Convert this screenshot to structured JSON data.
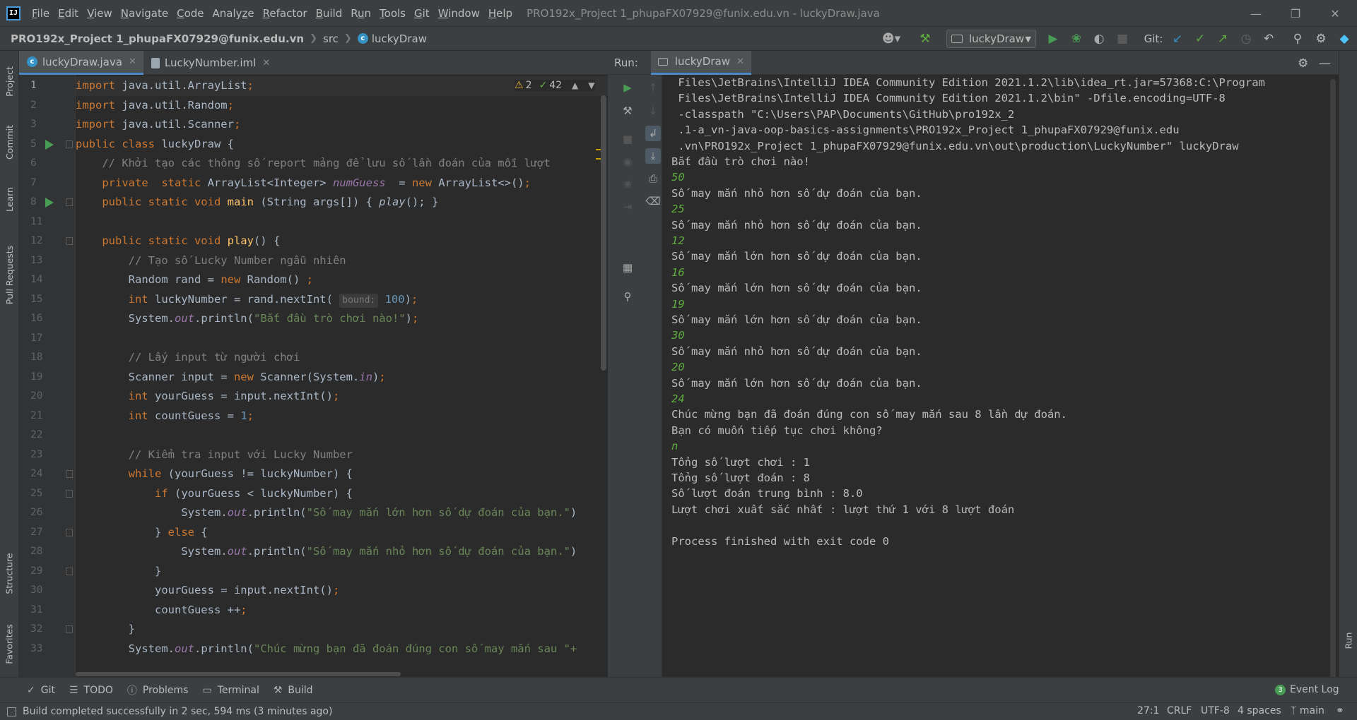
{
  "menubar": {
    "items": [
      "File",
      "Edit",
      "View",
      "Navigate",
      "Code",
      "Analyze",
      "Refactor",
      "Build",
      "Run",
      "Tools",
      "Git",
      "Window",
      "Help"
    ],
    "mnemonics": [
      "F",
      "E",
      "V",
      "N",
      "C",
      "z",
      "R",
      "B",
      "u",
      "T",
      "G",
      "W",
      "H"
    ],
    "window_title": "PRO192x_Project 1_phupaFX07929@funix.edu.vn - luckyDraw.java"
  },
  "navbar": {
    "project": "PRO192x_Project 1_phupaFX07929@funix.edu.vn",
    "folder": "src",
    "file": "luckyDraw",
    "run_config": "luckyDraw",
    "git_label": "Git:"
  },
  "editor": {
    "tabs": [
      {
        "label": "luckyDraw.java",
        "active": true
      },
      {
        "label": "LuckyNumber.iml",
        "active": false
      }
    ],
    "inspections": {
      "warnings": "2",
      "weak_warnings": "42"
    },
    "line_numbers": [
      "1",
      "2",
      "3",
      "5",
      "6",
      "7",
      "8",
      "11",
      "12",
      "13",
      "14",
      "15",
      "16",
      "17",
      "18",
      "19",
      "20",
      "21",
      "22",
      "23",
      "24",
      "25",
      "26",
      "27",
      "28",
      "29",
      "30",
      "31",
      "32",
      "33"
    ],
    "lines": [
      [
        [
          "k",
          "import "
        ],
        [
          "",
          "java.util.ArrayList"
        ],
        [
          "k",
          ";"
        ]
      ],
      [
        [
          "k",
          "import "
        ],
        [
          "",
          "java.util.Random"
        ],
        [
          "k",
          ";"
        ]
      ],
      [
        [
          "k",
          "import "
        ],
        [
          "",
          "java.util.Scanner"
        ],
        [
          "k",
          ";"
        ]
      ],
      [
        [
          "k",
          "public class "
        ],
        [
          "",
          "luckyDraw {"
        ]
      ],
      [
        [
          "c",
          "    // Khởi tạo các thông số report mảng để lưu số lần đoán của mỗi lượt"
        ]
      ],
      [
        [
          "k",
          "    private  static "
        ],
        [
          "",
          "ArrayList<Integer> "
        ],
        [
          "f",
          "numGuess"
        ],
        [
          "",
          "",
          " "
        ],
        [
          "",
          "",
          " "
        ],
        [
          "",
          "= "
        ],
        [
          "k",
          "new "
        ],
        [
          "",
          "ArrayList<>()"
        ],
        [
          "k",
          ";"
        ]
      ],
      [
        [
          "k",
          "    public static void "
        ],
        [
          "m",
          "main "
        ],
        [
          "",
          "(String args[]) { "
        ],
        [
          "i",
          "play"
        ],
        [
          "",
          "(); }"
        ]
      ],
      [
        [
          "",
          ""
        ]
      ],
      [
        [
          "k",
          "    public static void "
        ],
        [
          "m",
          "play"
        ],
        [
          "",
          "() {"
        ]
      ],
      [
        [
          "c",
          "        // Tạo số Lucky Number ngẫu nhiên"
        ]
      ],
      [
        [
          "",
          "        Random rand = "
        ],
        [
          "k",
          "new "
        ],
        [
          "",
          "Random() "
        ],
        [
          "k",
          ";"
        ]
      ],
      [
        [
          "k",
          "        int "
        ],
        [
          "",
          "luckyNumber = rand.nextInt( "
        ],
        [
          "hint",
          "bound:"
        ],
        [
          "n",
          " 100"
        ],
        [
          "",
          ")"
        ],
        [
          "k",
          ";"
        ]
      ],
      [
        [
          "",
          "        System."
        ],
        [
          "f",
          "out"
        ],
        [
          "",
          ".println("
        ],
        [
          "s",
          "\"Bắt đầu trò chơi nào!\""
        ],
        [
          "",
          ")"
        ],
        [
          "k",
          ";"
        ]
      ],
      [
        [
          "",
          ""
        ]
      ],
      [
        [
          "c",
          "        // Lấy input từ người chơi"
        ]
      ],
      [
        [
          "",
          "        Scanner input = "
        ],
        [
          "k",
          "new "
        ],
        [
          "",
          "Scanner(System."
        ],
        [
          "f",
          "in"
        ],
        [
          "",
          ")"
        ],
        [
          "k",
          ";"
        ]
      ],
      [
        [
          "k",
          "        int "
        ],
        [
          "",
          "yourGuess = input.nextInt()"
        ],
        [
          "k",
          ";"
        ]
      ],
      [
        [
          "k",
          "        int "
        ],
        [
          "",
          "countGuess = "
        ],
        [
          "n",
          "1"
        ],
        [
          "k",
          ";"
        ]
      ],
      [
        [
          "",
          ""
        ]
      ],
      [
        [
          "c",
          "        // Kiểm tra input với Lucky Number"
        ]
      ],
      [
        [
          "k",
          "        while "
        ],
        [
          "",
          "(yourGuess != luckyNumber) {"
        ]
      ],
      [
        [
          "k",
          "            if "
        ],
        [
          "",
          "(yourGuess < luckyNumber) {"
        ]
      ],
      [
        [
          "",
          "                System."
        ],
        [
          "f",
          "out"
        ],
        [
          "",
          ".println("
        ],
        [
          "s",
          "\"Số may mắn lớn hơn số dự đoán của bạn.\""
        ],
        [
          "",
          ")"
        ]
      ],
      [
        [
          "",
          "            } "
        ],
        [
          "k",
          "else "
        ],
        [
          "",
          "{"
        ]
      ],
      [
        [
          "",
          "                System."
        ],
        [
          "f",
          "out"
        ],
        [
          "",
          ".println("
        ],
        [
          "s",
          "\"Số may mắn nhỏ hơn số dự đoán của bạn.\""
        ],
        [
          "",
          ")"
        ]
      ],
      [
        [
          "",
          "            }"
        ]
      ],
      [
        [
          "",
          "            yourGuess = input.nextInt()"
        ],
        [
          "k",
          ";"
        ]
      ],
      [
        [
          "",
          "            countGuess ++"
        ],
        [
          "k",
          ";"
        ]
      ],
      [
        [
          "",
          "        }"
        ]
      ],
      [
        [
          "",
          "        System."
        ],
        [
          "f",
          "out"
        ],
        [
          "",
          ".println("
        ],
        [
          "s",
          "\"Chúc mừng bạn đã đoán đúng con số may mắn sau \"+"
        ]
      ]
    ]
  },
  "run_panel": {
    "label": "Run:",
    "tab": "luckyDraw",
    "output": [
      {
        "t": " Files\\JetBrains\\IntelliJ IDEA Community Edition 2021.1.2\\lib\\idea_rt.jar=57368:C:\\Program",
        "in": false
      },
      {
        "t": " Files\\JetBrains\\IntelliJ IDEA Community Edition 2021.1.2\\bin\" -Dfile.encoding=UTF-8",
        "in": false
      },
      {
        "t": " -classpath \"C:\\Users\\PAP\\Documents\\GitHub\\pro192x_2",
        "in": false
      },
      {
        "t": " .1-a_vn-java-oop-basics-assignments\\PRO192x_Project 1_phupaFX07929@funix.edu",
        "in": false
      },
      {
        "t": " .vn\\PRO192x_Project 1_phupaFX07929@funix.edu.vn\\out\\production\\LuckyNumber\" luckyDraw",
        "in": false
      },
      {
        "t": "Bắt đầu trò chơi nào!",
        "in": false
      },
      {
        "t": "50",
        "in": true
      },
      {
        "t": "Số may mắn nhỏ hơn số dự đoán của bạn.",
        "in": false
      },
      {
        "t": "25",
        "in": true
      },
      {
        "t": "Số may mắn nhỏ hơn số dự đoán của bạn.",
        "in": false
      },
      {
        "t": "12",
        "in": true
      },
      {
        "t": "Số may mắn lớn hơn số dự đoán của bạn.",
        "in": false
      },
      {
        "t": "16",
        "in": true
      },
      {
        "t": "Số may mắn lớn hơn số dự đoán của bạn.",
        "in": false
      },
      {
        "t": "19",
        "in": true
      },
      {
        "t": "Số may mắn lớn hơn số dự đoán của bạn.",
        "in": false
      },
      {
        "t": "30",
        "in": true
      },
      {
        "t": "Số may mắn nhỏ hơn số dự đoán của bạn.",
        "in": false
      },
      {
        "t": "20",
        "in": true
      },
      {
        "t": "Số may mắn lớn hơn số dự đoán của bạn.",
        "in": false
      },
      {
        "t": "24",
        "in": true
      },
      {
        "t": "Chúc mừng bạn đã đoán đúng con số may mắn sau 8 lần dự đoán.",
        "in": false
      },
      {
        "t": "Bạn có muốn tiếp tục chơi không?",
        "in": false
      },
      {
        "t": "n",
        "in": true
      },
      {
        "t": "Tổng số lượt chơi : 1",
        "in": false
      },
      {
        "t": "Tổng số lượt đoán : 8",
        "in": false
      },
      {
        "t": "Số lượt đoán trung bình : 8.0",
        "in": false
      },
      {
        "t": "Lượt chơi xuất sắc nhất : lượt thứ 1 với 8 lượt đoán",
        "in": false
      },
      {
        "t": "",
        "in": false
      },
      {
        "t": "Process finished with exit code 0",
        "in": false
      }
    ]
  },
  "left_stripe": [
    "Project",
    "Commit",
    "Learn",
    "Pull Requests",
    "Structure",
    "Favorites"
  ],
  "right_stripe": [
    "Run"
  ],
  "toolwindows": [
    "Git",
    "TODO",
    "Problems",
    "Terminal",
    "Build"
  ],
  "event_log": {
    "label": "Event Log",
    "count": "3"
  },
  "status": {
    "message": "Build completed successfully in 2 sec, 594 ms (3 minutes ago)",
    "position": "27:1",
    "line_sep": "CRLF",
    "encoding": "UTF-8",
    "indent": "4 spaces",
    "branch": "main"
  },
  "colors": {
    "keyword": "#cc7832",
    "string": "#6a8759",
    "number": "#6897bb",
    "comment": "#808080",
    "field": "#9876aa",
    "method": "#ffc66d",
    "user_input": "#5fab40",
    "run_green": "#499c54",
    "accent": "#4a88c7"
  }
}
